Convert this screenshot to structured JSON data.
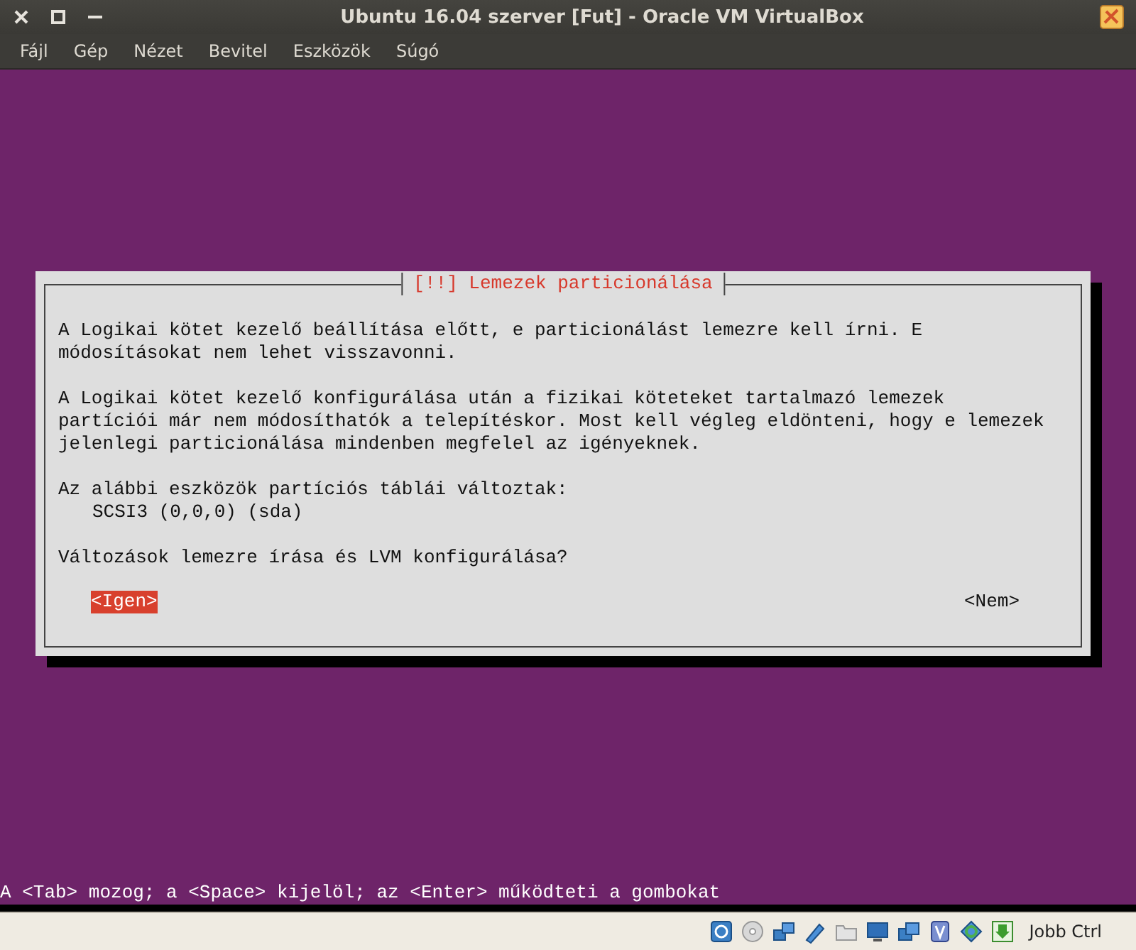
{
  "window": {
    "title": "Ubuntu 16.04 szerver [Fut] - Oracle VM VirtualBox"
  },
  "menu": [
    "Fájl",
    "Gép",
    "Nézet",
    "Bevitel",
    "Eszközök",
    "Súgó"
  ],
  "dialog": {
    "title": "[!!] Lemezek particionálása",
    "blocks": [
      {
        "kind": "paragraph",
        "lines": [
          "A Logikai kötet kezelő beállítása előtt, e particionálást lemezre kell írni. E",
          "módosításokat nem lehet visszavonni."
        ]
      },
      {
        "kind": "paragraph",
        "lines": [
          "A Logikai kötet kezelő konfigurálása után a fizikai köteteket tartalmazó lemezek",
          "partíciói már nem módosíthatók a telepítéskor. Most kell végleg eldönteni, hogy e lemezek",
          "jelenlegi particionálása mindenben megfelel az igényeknek."
        ]
      },
      {
        "kind": "device_list",
        "lines": [
          "Az alábbi eszközök partíciós táblái változtak:"
        ],
        "devices": [
          "SCSI3 (0,0,0) (sda)"
        ]
      },
      {
        "kind": "question",
        "lines": [
          "Változások lemezre írása és LVM konfigurálása?"
        ]
      }
    ],
    "buttons": [
      {
        "label": "<Igen>",
        "selected": true
      },
      {
        "label": "<Nem>",
        "selected": false
      }
    ]
  },
  "hint": "A <Tab> mozog; a <Space> kijelöl; az <Enter> működteti a gombokat",
  "status_bar": {
    "host_key": "Jobb Ctrl"
  }
}
